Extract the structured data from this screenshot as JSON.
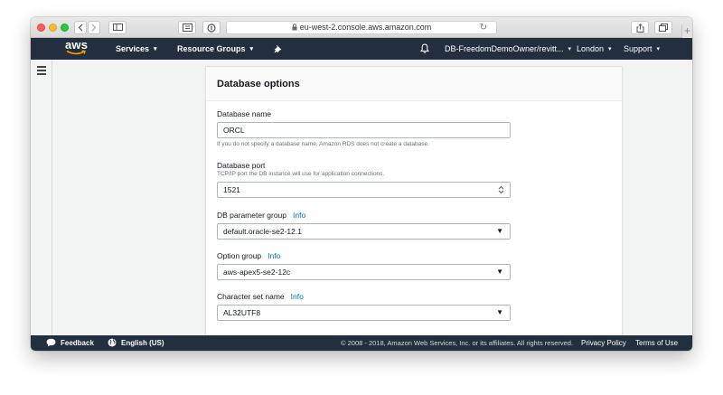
{
  "browser": {
    "url": "eu-west-2.console.aws.amazon.com",
    "icons": [
      "back-icon",
      "forward-icon",
      "sidebar-icon",
      "reader-icon",
      "privacy-icon",
      "lock-icon",
      "reload-icon",
      "share-icon",
      "tabs-icon",
      "new-tab-icon"
    ]
  },
  "nav": {
    "logo": "aws",
    "services": "Services",
    "resource_groups": "Resource Groups",
    "account": "DB-FreedomDemoOwner/revitt...",
    "region": "London",
    "support": "Support",
    "icons": [
      "pin-icon",
      "bell-icon"
    ]
  },
  "panel": {
    "title": "Database options",
    "fields": [
      {
        "label": "Database name",
        "value": "ORCL",
        "hint": "If you do not specify a database name, Amazon RDS does not create a database."
      },
      {
        "label": "Database port",
        "hint": "TCP/IP port the DB instance will use for application connections.",
        "value": "1521"
      },
      {
        "label": "DB parameter group",
        "info": "Info",
        "value": "default.oracle-se2-12.1"
      },
      {
        "label": "Option group",
        "info": "Info",
        "value": "aws-apex5-se2-12c"
      },
      {
        "label": "Character set name",
        "info": "Info",
        "value": "AL32UTF8"
      }
    ]
  },
  "footer": {
    "feedback": "Feedback",
    "language": "English (US)",
    "copyright": "© 2008 - 2018, Amazon Web Services, Inc. or its affiliates. All rights reserved.",
    "privacy": "Privacy Policy",
    "terms": "Terms of Use"
  },
  "colors": {
    "nav_bg": "#232f3e",
    "link": "#0073bb",
    "page_bg": "#f2f3f3"
  }
}
